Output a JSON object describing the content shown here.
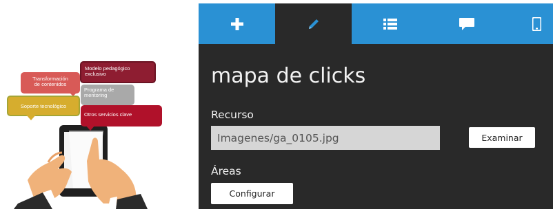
{
  "illustration": {
    "bubbles": [
      "Transformación\nde contenidos",
      "Modelo pedagógico\nexclusivo",
      "Programa de\nmentoring",
      "Soporte tecnológico",
      "Otros servicios clave"
    ]
  },
  "tabs": [
    {
      "icon": "plus-icon",
      "active": false
    },
    {
      "icon": "pencil-icon",
      "active": true
    },
    {
      "icon": "list-icon",
      "active": false
    },
    {
      "icon": "comment-icon",
      "active": false
    },
    {
      "icon": "mobile-icon",
      "active": false
    }
  ],
  "editor": {
    "title": "mapa de clicks",
    "resource_label": "Recurso",
    "resource_value": "Imagenes/ga_0105.jpg",
    "browse_button": "Examinar",
    "areas_label": "Áreas",
    "configure_button": "Configurar"
  },
  "colors": {
    "tab_bar": "#2a91d4",
    "panel_bg": "#292929",
    "input_bg": "#d6d6d6"
  }
}
